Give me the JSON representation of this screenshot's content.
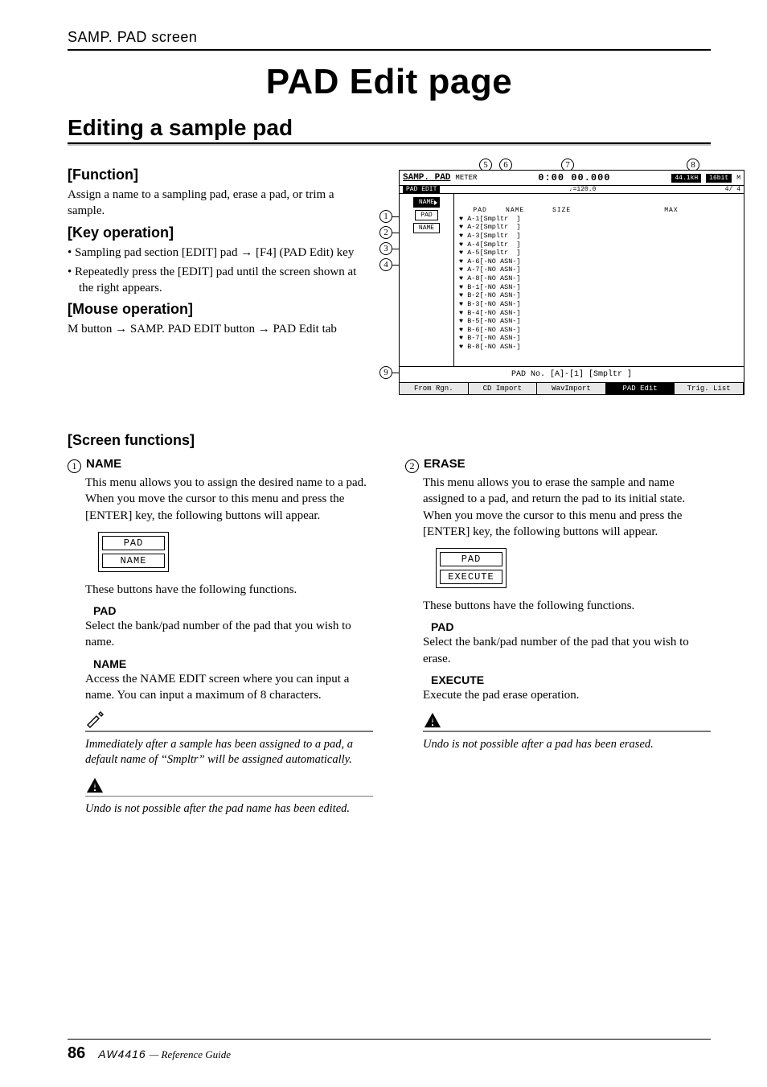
{
  "header": {
    "breadcrumb": "SAMP. PAD screen"
  },
  "title": "PAD Edit page",
  "section_title": "Editing a sample pad",
  "function": {
    "heading": "[Function]",
    "body": "Assign a name to a sampling pad, erase a pad, or trim a sample."
  },
  "key_operation": {
    "heading": "[Key operation]",
    "items": [
      "Sampling pad section [EDIT] pad → [F4] (PAD Edit) key",
      "Repeatedly press the [EDIT] pad until the screen shown at the right appears."
    ]
  },
  "mouse_operation": {
    "heading": "[Mouse operation]",
    "line1": "M button → SAMP. PAD EDIT button → PAD Edit tab"
  },
  "screenshot": {
    "app": "SAMP. PAD",
    "subapp": "PAD EDIT",
    "meter": "METER",
    "counter": "0:00 00.000",
    "rate": "44.1kH",
    "bits": "16bit",
    "tempo": "♩=120.0",
    "sig": "4/ 4",
    "m_icon": "M",
    "cols": {
      "pad": "PAD",
      "name": "NAME",
      "size": "SIZE",
      "max": "MAX"
    },
    "side_buttons": [
      "NAME",
      "PAD",
      "NAME"
    ],
    "pad_rows": [
      "A-1[Smpltr  ]",
      "A-2[Smpltr  ]",
      "A-3[Smpltr  ]",
      "A-4[Smpltr  ]",
      "A-5[Smpltr  ]",
      "A-6[-NO ASN-]",
      "A-7[-NO ASN-]",
      "A-8[-NO ASN-]",
      "B-1[-NO ASN-]",
      "B-2[-NO ASN-]",
      "B-3[-NO ASN-]",
      "B-4[-NO ASN-]",
      "B-5[-NO ASN-]",
      "B-6[-NO ASN-]",
      "B-7[-NO ASN-]",
      "B-8[-NO ASN-]"
    ],
    "status": "PAD No. [A]-[1]   [Smpltr  ]",
    "tabs": [
      "From Rgn.",
      "CD Import",
      "WavImport",
      "PAD Edit",
      "Trig. List"
    ],
    "callouts": [
      "1",
      "2",
      "3",
      "4",
      "5",
      "6",
      "7",
      "8",
      "9"
    ]
  },
  "screen_functions_title": "[Screen functions]",
  "item1": {
    "num": "1",
    "title": "NAME",
    "intro": "This menu allows you to assign the desired name to a pad. When you move the cursor to this menu and press the [ENTER] key, the following buttons will appear.",
    "buttons": [
      "PAD",
      "NAME"
    ],
    "buttons_caption": "These buttons have the following functions.",
    "pad_head": "PAD",
    "pad_body": "Select the bank/pad number of the pad that you wish to name.",
    "name_head": "NAME",
    "name_body": "Access the NAME EDIT screen where you can input a name. You can input a maximum of 8 characters.",
    "tip": "Immediately after a sample has been assigned to a pad, a default name of “Smpltr” will be assigned automatically.",
    "warn": "Undo is not possible after the pad name has been edited."
  },
  "item2": {
    "num": "2",
    "title": "ERASE",
    "intro": "This menu allows you to erase the sample and name assigned to a pad, and return the pad to its initial state. When you move the cursor to this menu and press the [ENTER] key, the following buttons will appear.",
    "buttons": [
      "PAD",
      "EXECUTE"
    ],
    "buttons_caption": "These buttons have the following functions.",
    "pad_head": "PAD",
    "pad_body": "Select the bank/pad number of the pad that you wish to erase.",
    "exec_head": "EXECUTE",
    "exec_body": "Execute the pad erase operation.",
    "warn": "Undo is not possible after a pad has been erased."
  },
  "footer": {
    "page": "86",
    "product": "AW4416",
    "ref": "— Reference Guide"
  }
}
